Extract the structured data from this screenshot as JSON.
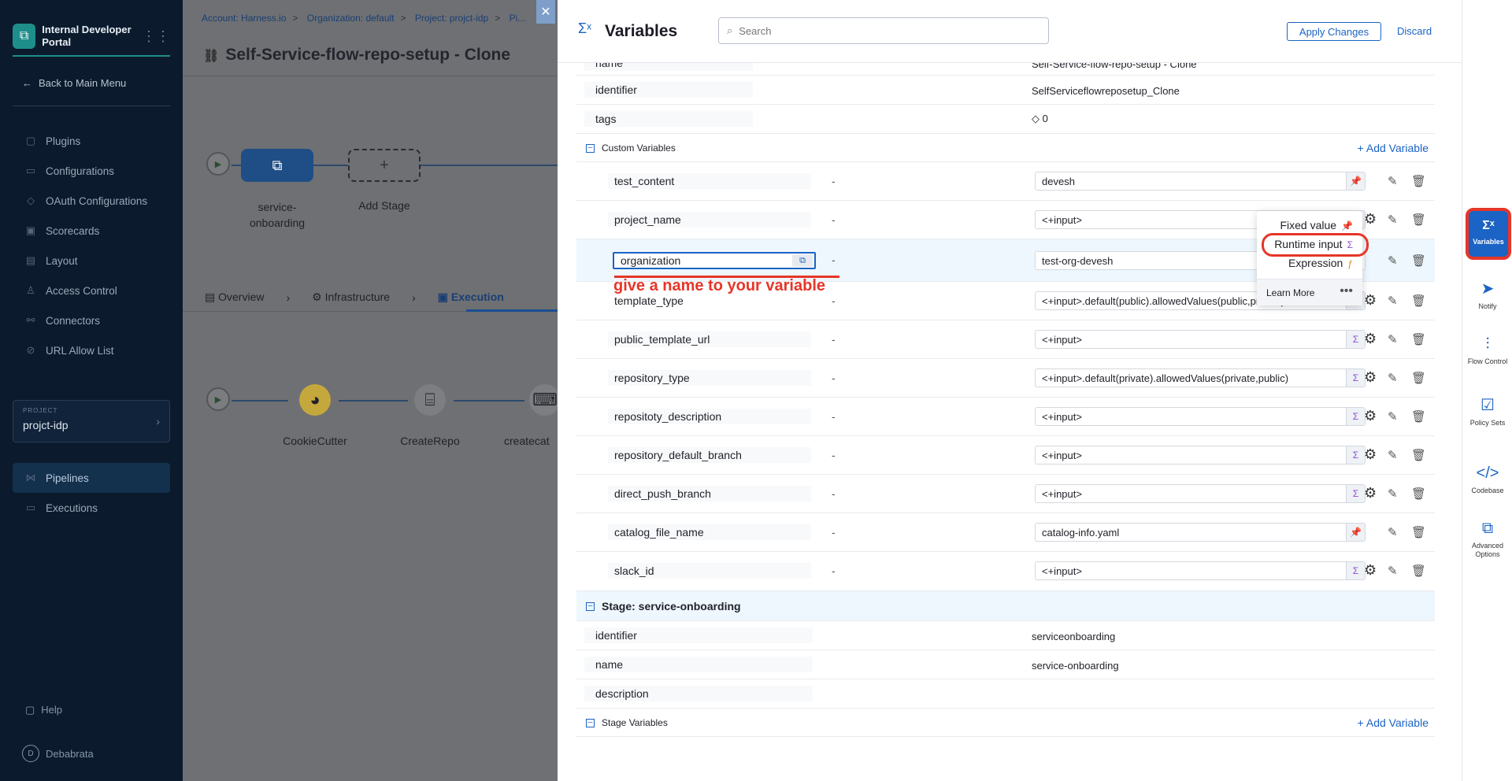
{
  "leftnav": {
    "brand": "Internal Developer Portal",
    "back": "Back to Main Menu",
    "items": [
      "Plugins",
      "Configurations",
      "OAuth Configurations",
      "Scorecards",
      "Layout",
      "Access Control",
      "Connectors",
      "URL Allow List"
    ],
    "project_tag": "PROJECT",
    "project_name": "projct-idp",
    "items2": [
      "Pipelines",
      "Executions"
    ],
    "help": "Help",
    "user_initial": "D",
    "user": "Debabrata"
  },
  "studio": {
    "crumbs": [
      "Account: Harness.io",
      "Organization: default",
      "Project: projct-idp",
      "Pi..."
    ],
    "title": "Self-Service-flow-repo-setup - Clone",
    "stage_label_1": "service-",
    "stage_label_2": "onboarding",
    "add_stage": "Add Stage",
    "tabs": [
      "Overview",
      "Infrastructure",
      "Execution"
    ],
    "steps": [
      "CookieCutter",
      "CreateRepo",
      "createcat"
    ]
  },
  "drawer": {
    "title": "Variables",
    "search_placeholder": "Search",
    "apply": "Apply Changes",
    "discard": "Discard",
    "pipeline": {
      "name_label": "name",
      "name_value": "Self-Service-flow-repo-setup - Clone",
      "identifier_label": "identifier",
      "identifier_value": "SelfServiceflowreposetup_Clone",
      "tags_label": "tags",
      "tags_value": "0"
    },
    "custom_header": "Custom Variables",
    "add_variable": "Add Variable",
    "dash": "-",
    "variables": [
      {
        "name": "test_content",
        "value": "devesh",
        "type": "fixed"
      },
      {
        "name": "project_name",
        "value": "<+input>",
        "type": "runtime"
      },
      {
        "name": "organization",
        "value": "test-org-devesh",
        "type": "fixed"
      },
      {
        "name": "template_type",
        "value": "<+input>.default(public).allowedValues(public,private)",
        "type": "runtime"
      },
      {
        "name": "public_template_url",
        "value": "<+input>",
        "type": "runtime"
      },
      {
        "name": "repository_type",
        "value": "<+input>.default(private).allowedValues(private,public)",
        "type": "runtime"
      },
      {
        "name": "repositoty_description",
        "value": "<+input>",
        "type": "runtime"
      },
      {
        "name": "repository_default_branch",
        "value": "<+input>",
        "type": "runtime"
      },
      {
        "name": "direct_push_branch",
        "value": "<+input>",
        "type": "runtime"
      },
      {
        "name": "catalog_file_name",
        "value": "catalog-info.yaml",
        "type": "fixed"
      },
      {
        "name": "slack_id",
        "value": "<+input>",
        "type": "runtime"
      }
    ],
    "annotation": "give a name to your variable",
    "stage_header": "Stage: service-onboarding",
    "stage": {
      "identifier_label": "identifier",
      "identifier_value": "serviceonboarding",
      "name_label": "name",
      "name_value": "service-onboarding",
      "description_label": "description"
    },
    "stage_vars_header": "Stage Variables"
  },
  "popup": {
    "fixed": "Fixed value",
    "runtime": "Runtime input",
    "expression": "Expression",
    "learn_more": "Learn More"
  },
  "rail": {
    "variables": "Variables",
    "notify": "Notify",
    "flow_control": "Flow Control",
    "policy_sets": "Policy Sets",
    "codebase": "Codebase",
    "advanced": "Advanced Options"
  },
  "colors": {
    "accent": "#1b63c4",
    "annotation_red": "#e63628",
    "nav_bg": "#0b1b2d"
  }
}
